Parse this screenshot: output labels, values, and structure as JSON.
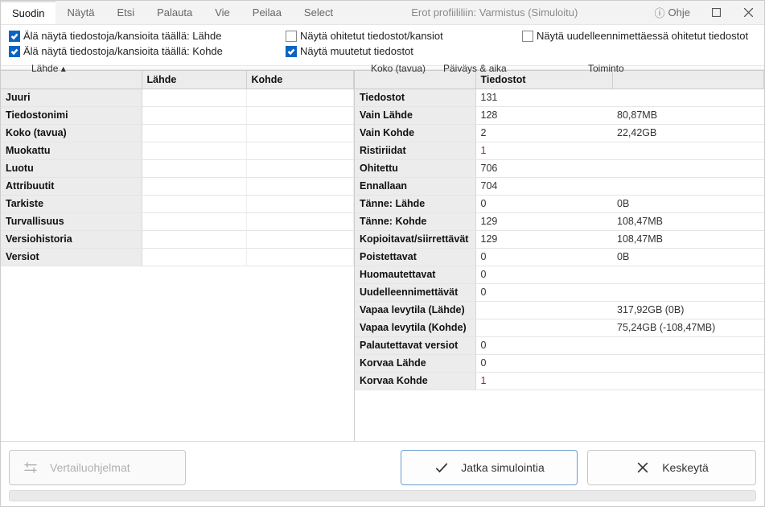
{
  "menubar": {
    "items": [
      "Suodin",
      "Näytä",
      "Etsi",
      "Palauta",
      "Vie",
      "Peilaa",
      "Select"
    ],
    "active_index": 0,
    "title": "Erot profiililiin: Varmistus (Simuloitu)",
    "help": "Ohje"
  },
  "filters": {
    "hide_source": "Älä näytä tiedostoja/kansioita täällä: Lähde",
    "hide_target": "Älä näytä tiedostoja/kansioita täällä: Kohde",
    "show_skipped": "Näytä ohitetut tiedostot/kansiot",
    "show_changed": "Näytä muutetut tiedostot",
    "show_rename_skipped": "Näytä uudelleennimettäessä ohitetut tiedostot"
  },
  "upper_cols": {
    "c1": "Lähde ▴",
    "c2": "Koko (tavua)",
    "c3": "Päiväys & aika",
    "c4": "Toiminto"
  },
  "left": {
    "headers": [
      "",
      "Lähde",
      "Kohde"
    ],
    "rows": [
      {
        "label": "Juuri",
        "source": "",
        "target": ""
      },
      {
        "label": "Tiedostonimi",
        "source": "",
        "target": ""
      },
      {
        "label": "Koko (tavua)",
        "source": "",
        "target": ""
      },
      {
        "label": "Muokattu",
        "source": "",
        "target": ""
      },
      {
        "label": "Luotu",
        "source": "",
        "target": ""
      },
      {
        "label": "Attribuutit",
        "source": "",
        "target": ""
      },
      {
        "label": "Tarkiste",
        "source": "",
        "target": ""
      },
      {
        "label": "Turvallisuus",
        "source": "",
        "target": ""
      },
      {
        "label": "Versiohistoria",
        "source": "",
        "target": ""
      },
      {
        "label": "Versiot",
        "source": "",
        "target": ""
      }
    ]
  },
  "right": {
    "headers": [
      "",
      "Tiedostot",
      ""
    ],
    "rows": [
      {
        "label": "Tiedostot",
        "count": "131",
        "size": ""
      },
      {
        "label": "Vain Lähde",
        "count": "128",
        "size": "80,87MB"
      },
      {
        "label": "Vain Kohde",
        "count": "2",
        "size": "22,42GB"
      },
      {
        "label": "Ristiriidat",
        "count": "1",
        "size": "",
        "red": true
      },
      {
        "label": "Ohitettu",
        "count": "706",
        "size": ""
      },
      {
        "label": "Ennallaan",
        "count": "704",
        "size": ""
      },
      {
        "label": "Tänne: Lähde",
        "count": "0",
        "size": "0B"
      },
      {
        "label": "Tänne: Kohde",
        "count": "129",
        "size": "108,47MB"
      },
      {
        "label": "Kopioitavat/siirrettävät",
        "count": "129",
        "size": "108,47MB"
      },
      {
        "label": "Poistettavat",
        "count": "0",
        "size": "0B"
      },
      {
        "label": "Huomautettavat",
        "count": "0",
        "size": ""
      },
      {
        "label": "Uudelleennimettävät",
        "count": "0",
        "size": ""
      },
      {
        "label": "Vapaa levytila (Lähde)",
        "count": "",
        "size": "317,92GB (0B)"
      },
      {
        "label": "Vapaa levytila (Kohde)",
        "count": "",
        "size": "75,24GB (-108,47MB)"
      },
      {
        "label": "Palautettavat versiot",
        "count": "0",
        "size": ""
      },
      {
        "label": "Korvaa Lähde",
        "count": "0",
        "size": ""
      },
      {
        "label": "Korvaa Kohde",
        "count": "1",
        "size": "",
        "red": true
      }
    ]
  },
  "footer": {
    "compare": "Vertailuohjelmat",
    "continue": "Jatka simulointia",
    "cancel": "Keskeytä"
  }
}
